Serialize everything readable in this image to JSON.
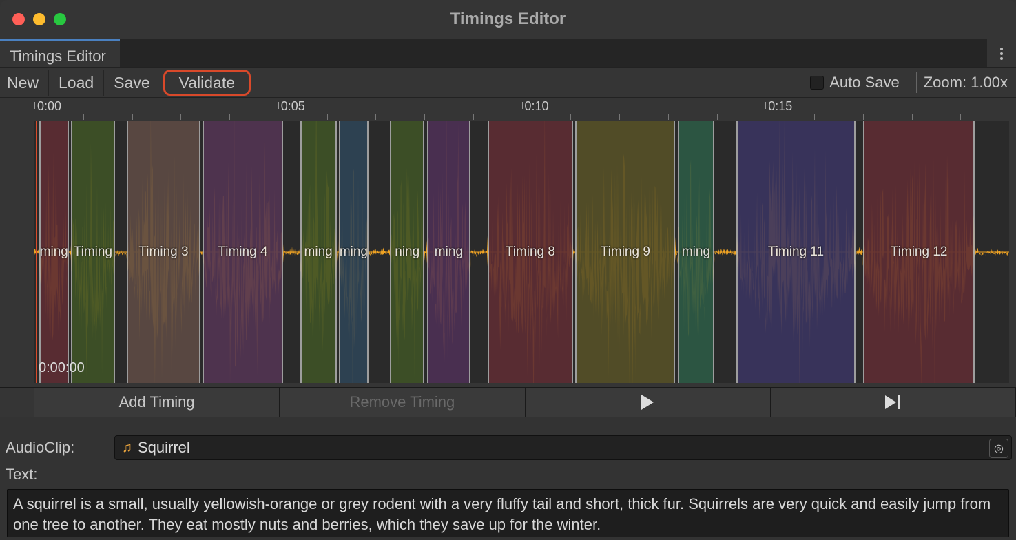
{
  "window": {
    "title": "Timings Editor"
  },
  "tab": {
    "title": "Timings Editor"
  },
  "toolbar": {
    "new_label": "New",
    "load_label": "Load",
    "save_label": "Save",
    "validate_label": "Validate",
    "auto_save_label": "Auto Save",
    "zoom_label": "Zoom: 1.00x"
  },
  "timeline": {
    "playhead_time": "0:00:00",
    "duration_seconds": 20,
    "ruler_majors": [
      {
        "time": "0:00",
        "t": 0
      },
      {
        "time": "0:05",
        "t": 5
      },
      {
        "time": "0:10",
        "t": 10
      },
      {
        "time": "0:15",
        "t": 15
      }
    ],
    "regions": [
      {
        "label": "ming",
        "start": 0.1,
        "end": 0.7,
        "color": "#5e2d33"
      },
      {
        "label": "Timing",
        "start": 0.75,
        "end": 1.65,
        "color": "#3e5326"
      },
      {
        "label": "Timing 3",
        "start": 1.9,
        "end": 3.4,
        "color": "#5d4b44"
      },
      {
        "label": "Timing 4",
        "start": 3.45,
        "end": 5.1,
        "color": "#533552"
      },
      {
        "label": "ming",
        "start": 5.45,
        "end": 6.2,
        "color": "#3e5326"
      },
      {
        "label": "ming",
        "start": 6.25,
        "end": 6.85,
        "color": "#2e4456"
      },
      {
        "label": "ning",
        "start": 7.3,
        "end": 8.0,
        "color": "#3e5326"
      },
      {
        "label": "ming",
        "start": 8.05,
        "end": 8.95,
        "color": "#4d3055"
      },
      {
        "label": "Timing 8",
        "start": 9.3,
        "end": 11.05,
        "color": "#5e2d33"
      },
      {
        "label": "Timing 9",
        "start": 11.1,
        "end": 13.15,
        "color": "#565027"
      },
      {
        "label": "ming",
        "start": 13.2,
        "end": 13.95,
        "color": "#2d5a45"
      },
      {
        "label": "Timing 11",
        "start": 14.4,
        "end": 16.85,
        "color": "#3a3560"
      },
      {
        "label": "Timing 12",
        "start": 17.0,
        "end": 19.3,
        "color": "#5e2d33"
      }
    ]
  },
  "controls": {
    "add_timing_label": "Add Timing",
    "remove_timing_label": "Remove Timing"
  },
  "fields": {
    "audioclip_label": "AudioClip:",
    "audioclip_value": "Squirrel",
    "text_label": "Text:",
    "text_value": "A squirrel is a small, usually yellowish-orange or grey rodent with a very fluffy tail and short, thick fur. Squirrels are very quick and easily jump from one tree to another. They eat mostly nuts and berries, which they save up for the winter."
  },
  "colors": {
    "waveform": "#f5a623",
    "highlight": "#d9492a"
  }
}
